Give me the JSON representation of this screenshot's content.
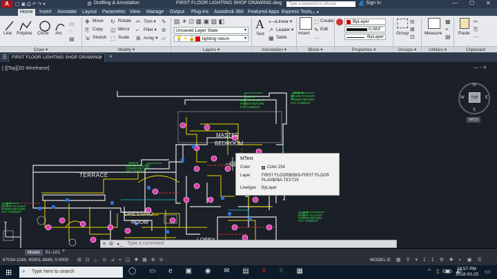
{
  "titlebar": {
    "workspace": "Drafting & Annotation",
    "document_title": "FIRST FLOOR LIGHTING SHOP DRAWING.dwg",
    "search_placeholder": "Type a keyword or phrase",
    "signin": "Sign In"
  },
  "menu": [
    "Home",
    "Insert",
    "Annotate",
    "Layout",
    "Parametric",
    "View",
    "Manage",
    "Output",
    "Plug-ins",
    "Autodesk 360",
    "Featured Apps",
    "Express Tools"
  ],
  "ribbon": {
    "draw": {
      "line": "Line",
      "polyline": "Polyline",
      "circle": "Circle",
      "arc": "Arc",
      "label": "Draw ▾"
    },
    "modify": {
      "move": "Move",
      "copy": "Copy",
      "stretch": "Stretch",
      "rotate": "Rotate",
      "mirror": "Mirror",
      "scale": "Scale",
      "trim": "Trim ▾",
      "fillet": "Fillet ▾",
      "array": "Array ▾",
      "label": "Modify ▾"
    },
    "layers": {
      "layer_state": "Unsaved Layer State",
      "current_layer": "lighting return",
      "label": "Layers ▾"
    },
    "annotation": {
      "text": "Text",
      "linear": "Linear ▾",
      "leader": "Leader ▾",
      "table": "Table",
      "label": "Annotation ▾"
    },
    "block": {
      "insert": "Insert",
      "create": "Create",
      "edit": "Edit",
      "label": "Block ▾"
    },
    "properties": {
      "color": "ByLayer",
      "lineweight": "0.083\"",
      "linetype": "ByLayer",
      "label": "Properties ▾"
    },
    "groups": {
      "group": "Group",
      "label": "Groups ▾"
    },
    "utilities": {
      "measure": "Measure",
      "label": "Utilities ▾"
    },
    "clipboard": {
      "paste": "Paste",
      "label": "Clipboard"
    }
  },
  "drawing_tab": "FIRST FLOOR LIGHTING SHOP DRAWING*",
  "viewport_label": "[-][Top][2D Wireframe]",
  "viewcube": {
    "top": "TOP",
    "n": "N",
    "s": "S",
    "e": "E",
    "w": "W",
    "wcs": "WCS"
  },
  "room_labels": {
    "terrace": "TERRACE",
    "master": "MASTER",
    "bedroom": "BEDROOM",
    "dressing": "DRESSING",
    "room": "ROOM",
    "lobby": "LOBBY"
  },
  "tooltip": {
    "title": "MText",
    "color_label": "Color",
    "color_value": "Color 254",
    "layer_label": "Layer",
    "layer_value_1": "FIRST FLOOR$0$03-FIRST FLOOR",
    "layer_value_2": "PLAN$0$A-TEXT25",
    "linetype_label": "Linetype",
    "linetype_value": "ByLayer"
  },
  "command_placeholder": "Type a command",
  "layout_tabs": [
    "Model",
    "EL-101"
  ],
  "status": {
    "coords": "67034.1184, 65951.8889, 0.0000",
    "model": "MODEL"
  },
  "taskbar": {
    "search": "Type here to search",
    "time": "12:57 PM",
    "date": "2018-03-25",
    "lang": "ENG"
  },
  "colors": {
    "accent": "#2f6fd0",
    "background": "#1b1f27",
    "annotation_green": "#39e64a"
  }
}
